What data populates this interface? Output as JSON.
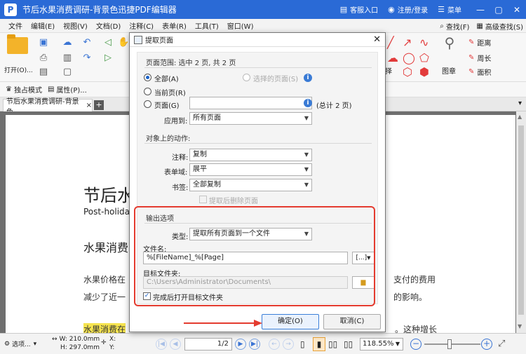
{
  "window": {
    "title": "节后水果消费调研-背景色迅捷PDF编辑器",
    "logo": "P",
    "customer_label": "客服入口",
    "login_label": "注册/登录",
    "menu_label": "菜单",
    "minimize": "—",
    "maximize": "▢",
    "close": "✕"
  },
  "menubar": {
    "items": [
      "文件",
      "编辑(E)",
      "视图(V)",
      "文档(D)",
      "注释(C)",
      "表单(R)",
      "工具(T)",
      "窗口(W)"
    ],
    "find_label": "查找(F)",
    "advfind_label": "高级查找(S)"
  },
  "ribbon": {
    "open_label": "打开(O)...",
    "image_label": "图章",
    "distance_label": "距离",
    "perimeter_label": "周长",
    "area_label": "面积",
    "extract_tail": "选择"
  },
  "row2": {
    "exclusive_label": "独占模式",
    "props_label": "属性(P)..."
  },
  "doc_tab": {
    "label": "节后水果消费调研-背景色",
    "close": "×",
    "add": "+"
  },
  "document": {
    "title_partial": "节后水",
    "sub_partial": "Post-holiday",
    "heading_partial": "水果消费",
    "p1_left": "水果价格在",
    "p1_right": "支付的费用",
    "p2_left": "减少了近一",
    "p2_right": "的影响。",
    "p3_left": "水果消费在",
    "p3_right": "。这种增长"
  },
  "dialog": {
    "title": "提取页面",
    "close": "✕",
    "range_head": "页面范围: 选中 2 页, 共 2 页",
    "opt_all": "全部(A)",
    "opt_selected": "选择的页面(S)",
    "opt_current": "当前页(R)",
    "opt_pages": "页面(G)",
    "total_label": "(总计 2 页)",
    "apply_label": "应用到:",
    "apply_value": "所有页面",
    "actions_head": "对象上的动作:",
    "annot_label": "注释:",
    "annot_value": "复制",
    "form_label": "表单域:",
    "form_value": "展平",
    "bookmark_label": "书签:",
    "bookmark_value": "全部复制",
    "delete_after_label": "提取后删除页面",
    "output_head": "输出选项",
    "type_label": "类型:",
    "type_value": "提取所有页面到一个文件",
    "filename_label": "文件名:",
    "filename_value": "%[FileName]_%[Page]",
    "macro_btn": "[...]",
    "folder_label": "目标文件夹:",
    "folder_value": "C:\\Users\\Administrator\\Documents\\",
    "open_after_label": "完成后打开目标文件夹",
    "ok_label": "确定(O)",
    "cancel_label": "取消(C)"
  },
  "statusbar": {
    "select_label": "选项...",
    "w_label": "W: 210.0mm",
    "h_label": "H: 297.0mm",
    "x_label": "X:",
    "y_label": "Y:",
    "page_value": "1",
    "page_total": "/2",
    "zoom_value": "118.55%",
    "zoom_fraction": 0.45
  },
  "colors": {
    "titlebar": "#2a6ad6",
    "highlight_box": "#e43b2f",
    "doc_highlight": "#f6e44f"
  }
}
